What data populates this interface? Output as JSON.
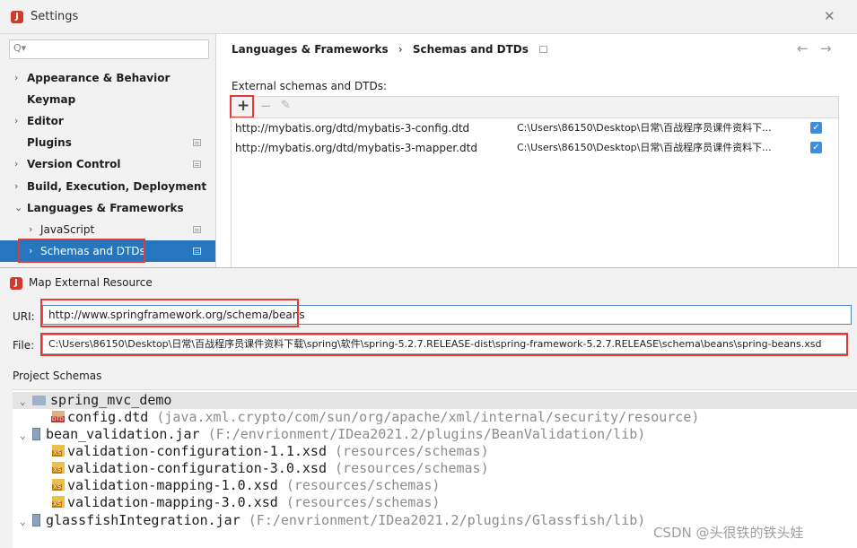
{
  "settings": {
    "title": "Settings",
    "app_icon": "intellij-icon",
    "close_glyph": "✕",
    "search": {
      "placeholder": "Q▾"
    },
    "nav": [
      {
        "label": "Appearance & Behavior",
        "arrow": "›"
      },
      {
        "label": "Keymap",
        "arrow": ""
      },
      {
        "label": "Editor",
        "arrow": "›"
      },
      {
        "label": "Plugins",
        "arrow": ""
      },
      {
        "label": "Version Control",
        "arrow": "›"
      },
      {
        "label": "Build, Execution, Deployment",
        "arrow": "›"
      },
      {
        "label": "Languages & Frameworks",
        "arrow": "⌄"
      },
      {
        "label": "JavaScript",
        "arrow": "›"
      },
      {
        "label": "Schemas and DTDs",
        "arrow": "›"
      }
    ],
    "breadcrumb": {
      "parent": "Languages & Frameworks",
      "separator": "›",
      "current": "Schemas and DTDs"
    },
    "back_arrow": "←",
    "forward_arrow": "→",
    "section_label": "External schemas and DTDs:",
    "toolbar": {
      "add": "+",
      "remove": "−",
      "edit": "✎"
    },
    "rows": [
      {
        "uri": "http://mybatis.org/dtd/mybatis-3-config.dtd",
        "location": "C:\\Users\\86150\\Desktop\\日常\\百战程序员课件资料下...",
        "checked": true
      },
      {
        "uri": "http://mybatis.org/dtd/mybatis-3-mapper.dtd",
        "location": "C:\\Users\\86150\\Desktop\\日常\\百战程序员课件资料下...",
        "checked": true
      }
    ],
    "check_glyph": "✓"
  },
  "dialog": {
    "title": "Map External Resource",
    "uri_label": "URI:",
    "uri_value": "http://www.springframework.org/schema/beans",
    "file_label": "File:",
    "file_value": "C:\\Users\\86150\\Desktop\\日常\\百战程序员课件资料下载\\spring\\软件\\spring-5.2.7.RELEASE-dist\\spring-framework-5.2.7.RELEASE\\schema\\beans\\spring-beans.xsd",
    "project_schemas_label": "Project Schemas",
    "tree": [
      {
        "arrow": "⌄",
        "name": "spring_mvc_demo",
        "path": "",
        "icon": "module-icon"
      },
      {
        "arrow": "",
        "name": "config.dtd",
        "path": " (java.xml.crypto/com/sun/org/apache/xml/internal/security/resource)",
        "icon": "dtd-file-icon"
      },
      {
        "arrow": "⌄",
        "name": "bean_validation.jar",
        "path": " (F:/envrionment/IDea2021.2/plugins/BeanValidation/lib)",
        "icon": "jar-icon"
      },
      {
        "arrow": "",
        "name": "validation-configuration-1.1.xsd",
        "path": " (resources/schemas)",
        "icon": "xsd-file-icon"
      },
      {
        "arrow": "",
        "name": "validation-configuration-3.0.xsd",
        "path": " (resources/schemas)",
        "icon": "xsd-file-icon"
      },
      {
        "arrow": "",
        "name": "validation-mapping-1.0.xsd",
        "path": " (resources/schemas)",
        "icon": "xsd-file-icon"
      },
      {
        "arrow": "",
        "name": "validation-mapping-3.0.xsd",
        "path": " (resources/schemas)",
        "icon": "xsd-file-icon"
      },
      {
        "arrow": "⌄",
        "name": "glassfishIntegration.jar",
        "path": " (F:/envrionment/IDea2021.2/plugins/Glassfish/lib)",
        "icon": "jar-icon"
      }
    ]
  },
  "watermark": "CSDN @头很铁的铁头娃",
  "colors": {
    "accent": "#2675bf",
    "highlight_red": "#e53935",
    "checkbox": "#3e8ede"
  }
}
